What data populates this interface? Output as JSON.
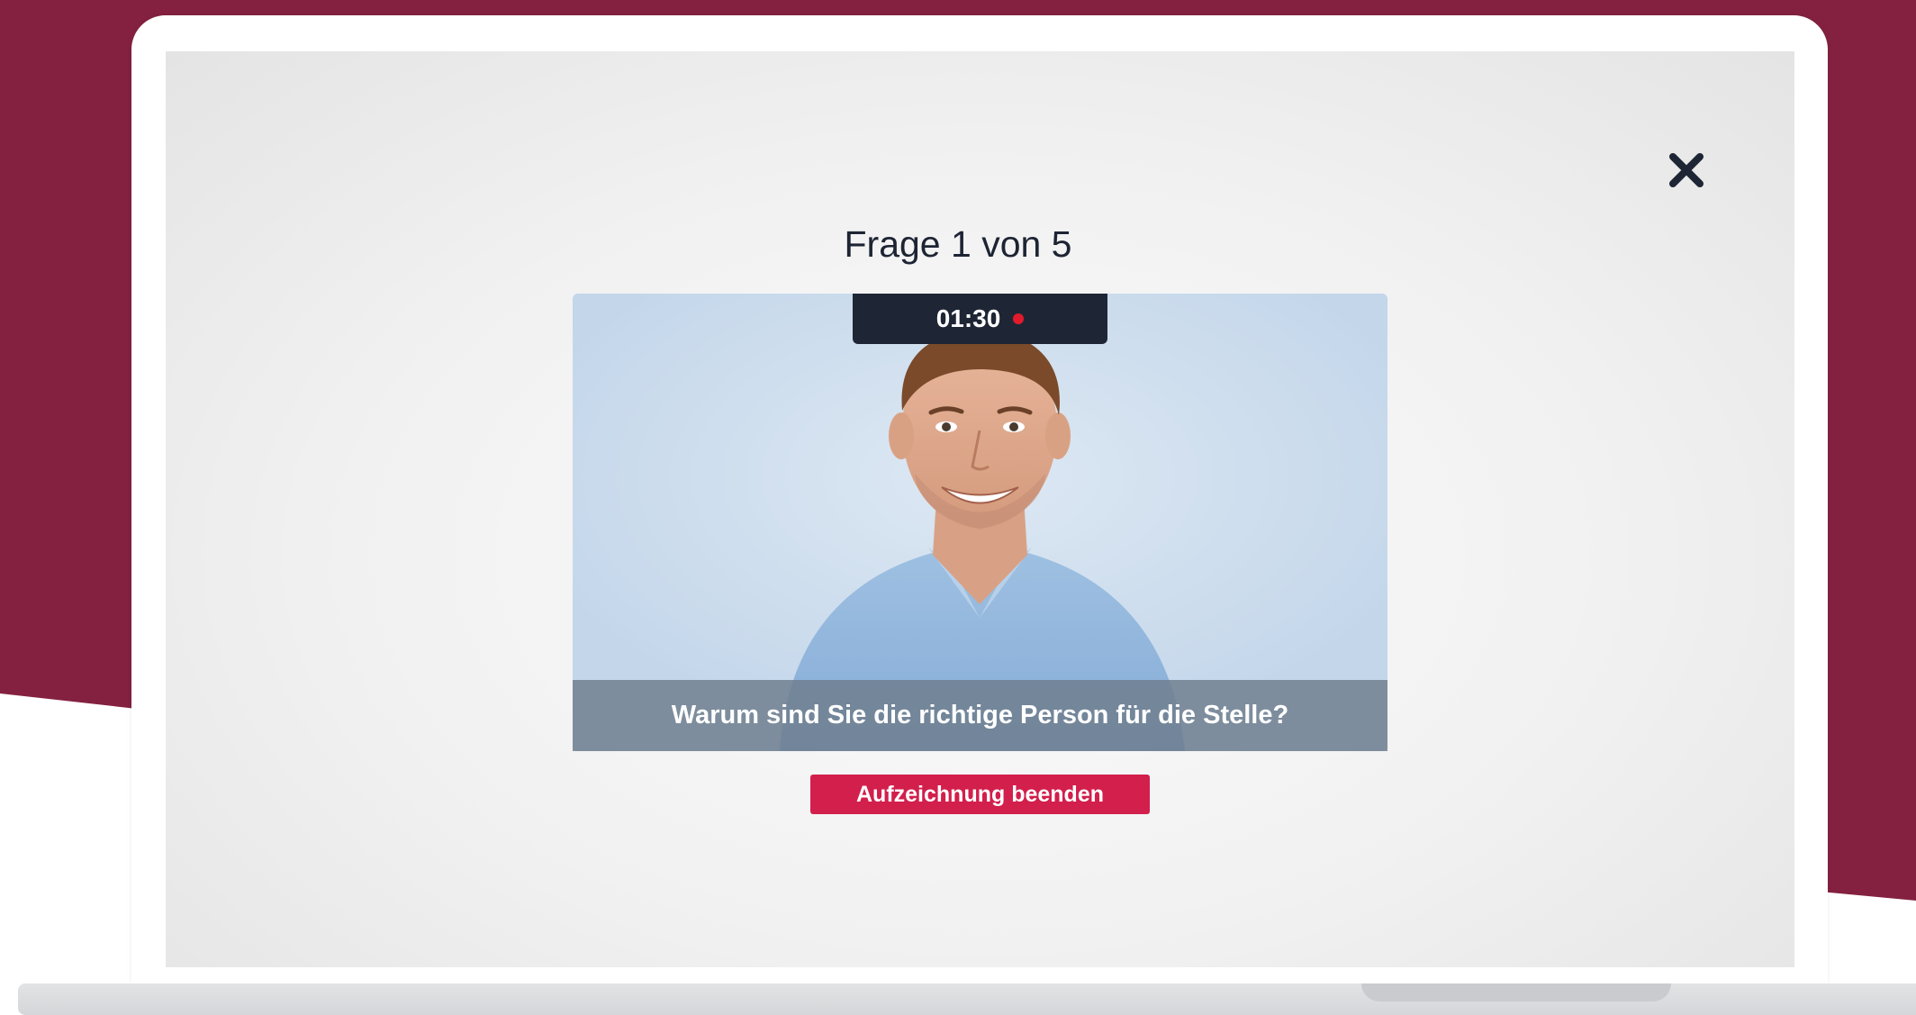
{
  "colors": {
    "brand_background": "#842140",
    "accent_button": "#d21f4c",
    "timer_background": "#1e2635",
    "recording_dot": "#e21b2c",
    "title_text": "#1d2433"
  },
  "header": {
    "title": "Frage 1 von 5",
    "close_icon": "close-icon"
  },
  "recording": {
    "timer": "01:30",
    "status_icon": "recording-dot-icon"
  },
  "question": {
    "text": "Warum sind Sie die richtige Person für die Stelle?"
  },
  "actions": {
    "end_recording_label": "Aufzeichnung beenden"
  }
}
